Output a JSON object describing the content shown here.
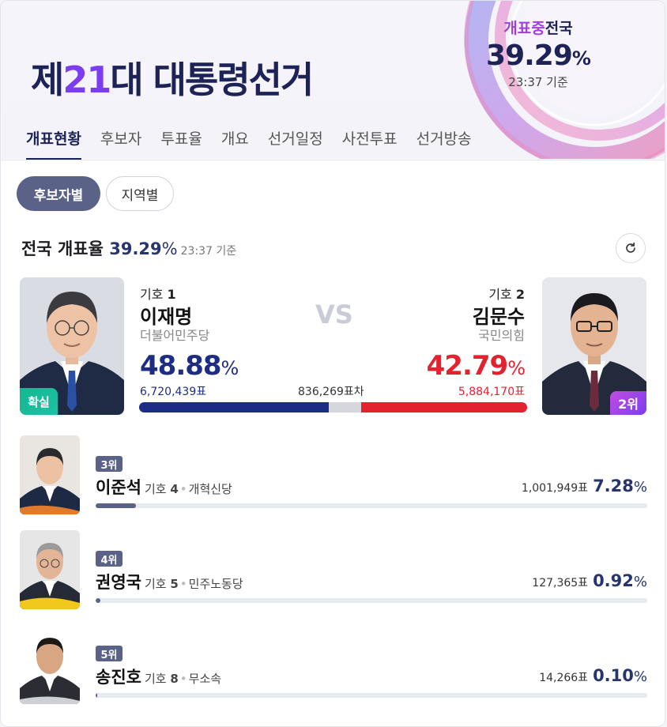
{
  "header": {
    "title_prefix": "제",
    "title_num": "21",
    "title_suffix": "대 대통령선거",
    "status_live": "개표중",
    "status_scope": "전국",
    "status_pct": "39.29",
    "status_unit": "%",
    "status_time": "23:37 기준"
  },
  "tabs": [
    "개표현황",
    "후보자",
    "투표율",
    "개요",
    "선거일정",
    "사전투표",
    "선거방송"
  ],
  "filters": {
    "candidate": "후보자별",
    "region": "지역별"
  },
  "rate": {
    "label": "전국 개표율",
    "pct": "39.29",
    "unit": "%",
    "time": "23:37 기준"
  },
  "top": {
    "left": {
      "num_label": "기호",
      "num": "1",
      "name": "이재명",
      "party": "더불어민주당",
      "pct": "48.88",
      "unit": "%",
      "votes": "6,720,439표",
      "badge": "확실",
      "share": 48.88
    },
    "right": {
      "num_label": "기호",
      "num": "2",
      "name": "김문수",
      "party": "국민의힘",
      "pct": "42.79",
      "unit": "%",
      "votes": "5,884,170표",
      "badge": "2위",
      "share": 42.79
    },
    "vs": "VS",
    "gap": "836,269표차"
  },
  "others": [
    {
      "rank": "3위",
      "name": "이준석",
      "num_label": "기호",
      "num": "4",
      "party": "개혁신당",
      "votes": "1,001,949표",
      "pct": "7.28",
      "unit": "%",
      "share": 7.28
    },
    {
      "rank": "4위",
      "name": "권영국",
      "num_label": "기호",
      "num": "5",
      "party": "민주노동당",
      "votes": "127,365표",
      "pct": "0.92",
      "unit": "%",
      "share": 0.92
    },
    {
      "rank": "5위",
      "name": "송진호",
      "num_label": "기호",
      "num": "8",
      "party": "무소속",
      "votes": "14,266표",
      "pct": "0.10",
      "unit": "%",
      "share": 0.1
    }
  ],
  "colors": {
    "navy": "#1d2356",
    "party1": "#1d2d84",
    "party2": "#e0232f",
    "accent": "#7b3df0",
    "win": "#13b890"
  },
  "icons": {
    "refresh": "refresh-icon"
  }
}
